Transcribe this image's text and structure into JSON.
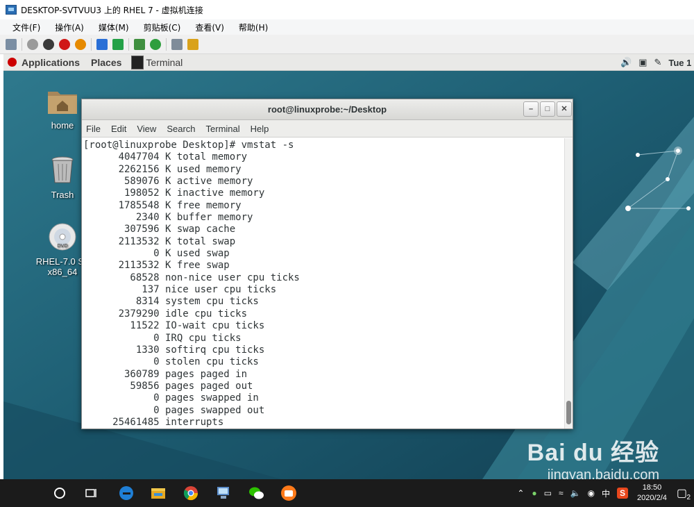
{
  "vm_window": {
    "title": "DESKTOP-SVTVUU3 上的 RHEL 7 - 虚拟机连接",
    "menu": [
      "文件(F)",
      "操作(A)",
      "媒体(M)",
      "剪贴板(C)",
      "查看(V)",
      "帮助(H)"
    ]
  },
  "gnome_topbar": {
    "applications": "Applications",
    "places": "Places",
    "task": "Terminal",
    "clock": "Tue 1 "
  },
  "desktop_icons": [
    {
      "label": "home",
      "icon": "home-folder-icon"
    },
    {
      "label": "Trash",
      "icon": "trash-icon"
    },
    {
      "label": "RHEL-7.0 Se",
      "icon": "dvd-icon"
    },
    {
      "label": "x86_64",
      "icon": "dvd-icon"
    }
  ],
  "terminal": {
    "title": "root@linuxprobe:~/Desktop",
    "menu": [
      "File",
      "Edit",
      "View",
      "Search",
      "Terminal",
      "Help"
    ],
    "lines": [
      "[root@linuxprobe Desktop]# vmstat -s",
      "      4047704 K total memory",
      "      2262156 K used memory",
      "       589076 K active memory",
      "       198052 K inactive memory",
      "      1785548 K free memory",
      "         2340 K buffer memory",
      "       307596 K swap cache",
      "      2113532 K total swap",
      "            0 K used swap",
      "      2113532 K free swap",
      "        68528 non-nice user cpu ticks",
      "          137 nice user cpu ticks",
      "         8314 system cpu ticks",
      "      2379290 idle cpu ticks",
      "        11522 IO-wait cpu ticks",
      "            0 IRQ cpu ticks",
      "         1330 softirq cpu ticks",
      "            0 stolen cpu ticks",
      "       360789 pages paged in",
      "        59856 pages paged out",
      "            0 pages swapped in",
      "            0 pages swapped out",
      "     25461485 interrupts"
    ]
  },
  "taskbar": {
    "time": "18:50",
    "date": "2020/2/4",
    "ime": "中",
    "notifications": "2"
  },
  "watermark": {
    "brand": "Bai du 经验",
    "url": "jingyan.baidu.com"
  }
}
